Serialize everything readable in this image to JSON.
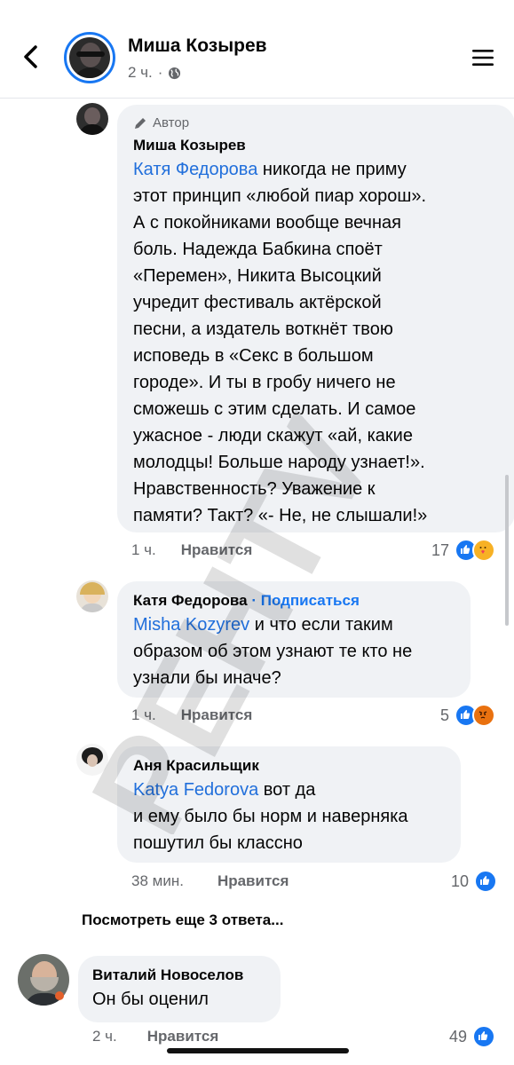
{
  "header": {
    "name": "Миша Козырев",
    "time": "2 ч.",
    "separator": "·"
  },
  "comments": [
    {
      "author_badge": "Автор",
      "name": "Миша Козырев",
      "mention": "Катя Федорова",
      "lines": [
        " никогда не приму",
        "этот принцип «любой пиар хорош».",
        "А с покойниками вообще вечная",
        "боль. Надежда Бабкина споёт",
        "«Перемен», Никита Высоцкий",
        "учредит фестиваль актёрской",
        "песни, а издатель воткнёт твою",
        "исповедь в «Секс в большом",
        "городе». И ты в гробу ничего не",
        "сможешь с этим сделать. И самое",
        "ужасное - люди скажут «ай, какие",
        "молодцы! Больше народу узнает!».",
        "Нравственность?  Уважение к",
        "памяти? Такт? «- Не, не слышали!»"
      ],
      "time": "1 ч.",
      "like_label": "Нравится",
      "reaction_count": "17"
    },
    {
      "name": "Катя Федорова",
      "follow": "· Подписаться",
      "mention": "Misha Kozyrev",
      "lines": [
        " и что если таким",
        "образом об этом узнают те кто не",
        "узнали бы иначе?"
      ],
      "time": "1 ч.",
      "like_label": "Нравится",
      "reaction_count": "5"
    },
    {
      "name": "Аня Красильщик",
      "mention": "Katya Fedorova",
      "lines": [
        " вот да",
        "и ему было бы норм и наверняка",
        "пошутил бы классно"
      ],
      "time": "38 мин.",
      "like_label": "Нравится",
      "reaction_count": "10"
    }
  ],
  "more_replies": "Посмотреть еще 3 ответа...",
  "bottom_comment": {
    "name": "Виталий Новоселов",
    "text": "Он бы оценил",
    "time": "2 ч.",
    "like_label": "Нравится",
    "reaction_count": "49"
  },
  "watermark_text": "PEHTV",
  "colors": {
    "accent": "#1877f2",
    "mention": "#216fdb",
    "bubble": "#f0f2f5",
    "meta": "#65676b"
  }
}
